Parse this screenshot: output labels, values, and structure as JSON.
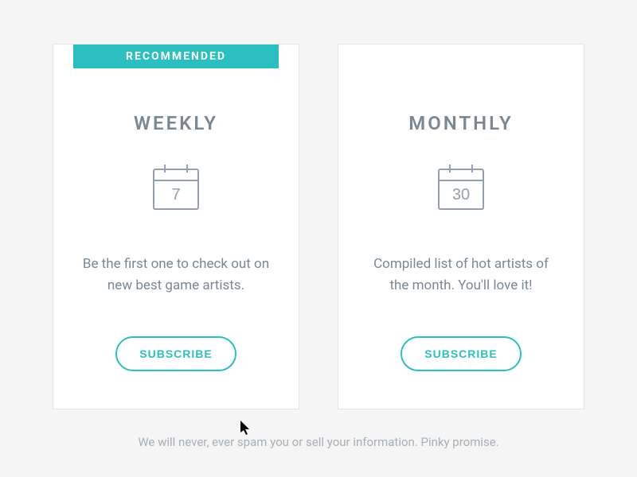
{
  "cards": [
    {
      "badge": "RECOMMENDED",
      "title": "WEEKLY",
      "calendar_number": "7",
      "description": "Be the first one to check out on new best game artists.",
      "button_label": "SUBSCRIBE"
    },
    {
      "badge": null,
      "title": "MONTHLY",
      "calendar_number": "30",
      "description": "Compiled list of hot artists of the month. You'll love it!",
      "button_label": "SUBSCRIBE"
    }
  ],
  "footer": "We will never, ever spam you or sell your information. Pinky promise.",
  "colors": {
    "accent": "#2bbfc0",
    "text_muted": "#7a8894",
    "text_light": "#a7b0b8",
    "card_bg": "#ffffff",
    "page_bg": "#f5f5f5"
  }
}
